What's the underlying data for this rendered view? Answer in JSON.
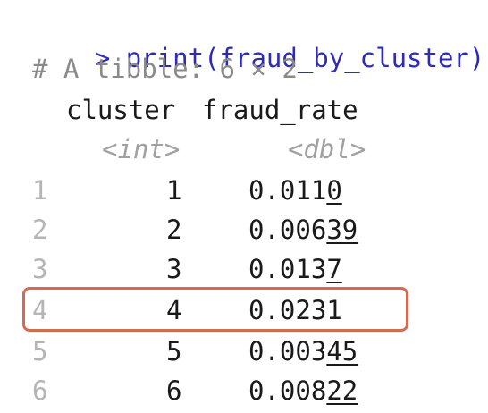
{
  "console": {
    "prompt_symbol": ">",
    "command": "print(fraud_by_cluster)",
    "comment": "# A tibble: 6 × 2",
    "columns": [
      {
        "name": "cluster",
        "type": "<int>"
      },
      {
        "name": "fraud_rate",
        "type": "<dbl>"
      }
    ],
    "rows": [
      {
        "index": "1",
        "cluster": "1",
        "rate_main": "0.011",
        "rate_underlined": "0"
      },
      {
        "index": "2",
        "cluster": "2",
        "rate_main": "0.006",
        "rate_underlined": "39"
      },
      {
        "index": "3",
        "cluster": "3",
        "rate_main": "0.013",
        "rate_underlined": "7"
      },
      {
        "index": "4",
        "cluster": "4",
        "rate_main": "0.0231",
        "rate_underlined": ""
      },
      {
        "index": "5",
        "cluster": "5",
        "rate_main": "0.003",
        "rate_underlined": "45"
      },
      {
        "index": "6",
        "cluster": "6",
        "rate_main": "0.008",
        "rate_underlined": "22"
      }
    ],
    "highlighted_row": "4",
    "highlight_color": "#d66a50",
    "prompt_color": "#2d2bb8"
  }
}
